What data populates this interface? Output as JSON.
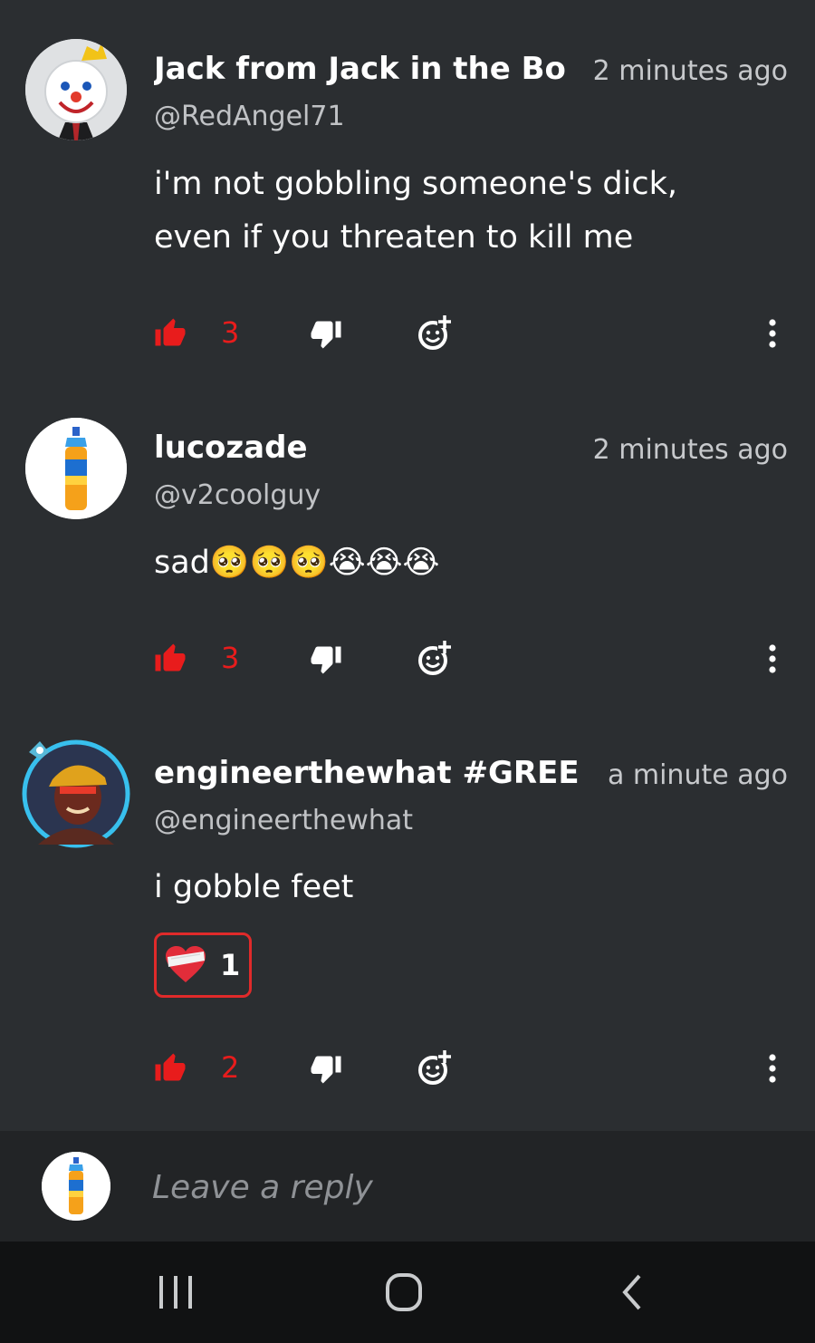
{
  "colors": {
    "background": "#2b2e31",
    "accent_red": "#e81c1c",
    "reply_bar": "#222426",
    "nav_bar": "#111213"
  },
  "comments": [
    {
      "display_name": "Jack from Jack in the Bo",
      "handle": "@RedAngel71",
      "timestamp": "2 minutes ago",
      "body_lines": [
        "i'm not gobbling someone's dick,",
        "even if you threaten to kill me"
      ],
      "likes": "3",
      "avatar": "jack-mascot-avatar"
    },
    {
      "display_name": "lucozade",
      "handle": "@v2coolguy",
      "timestamp": "2 minutes ago",
      "body_text": "sad",
      "emojis": [
        "🥺",
        "🥺",
        "🥺",
        "😭",
        "😭",
        "😭"
      ],
      "likes": "3",
      "avatar": "lucozade-bottle-avatar"
    },
    {
      "display_name": "engineerthewhat #GREE",
      "handle": "@engineerthewhat",
      "timestamp": "a minute ago",
      "body_lines": [
        "i gobble feet"
      ],
      "reaction": {
        "icon": "bandaged-heart-icon",
        "count": "1"
      },
      "likes": "2",
      "avatar": "engineer-avatar"
    }
  ],
  "reply": {
    "placeholder": "Leave a reply"
  },
  "nav": [
    "recent-apps-icon",
    "home-icon",
    "back-icon"
  ]
}
